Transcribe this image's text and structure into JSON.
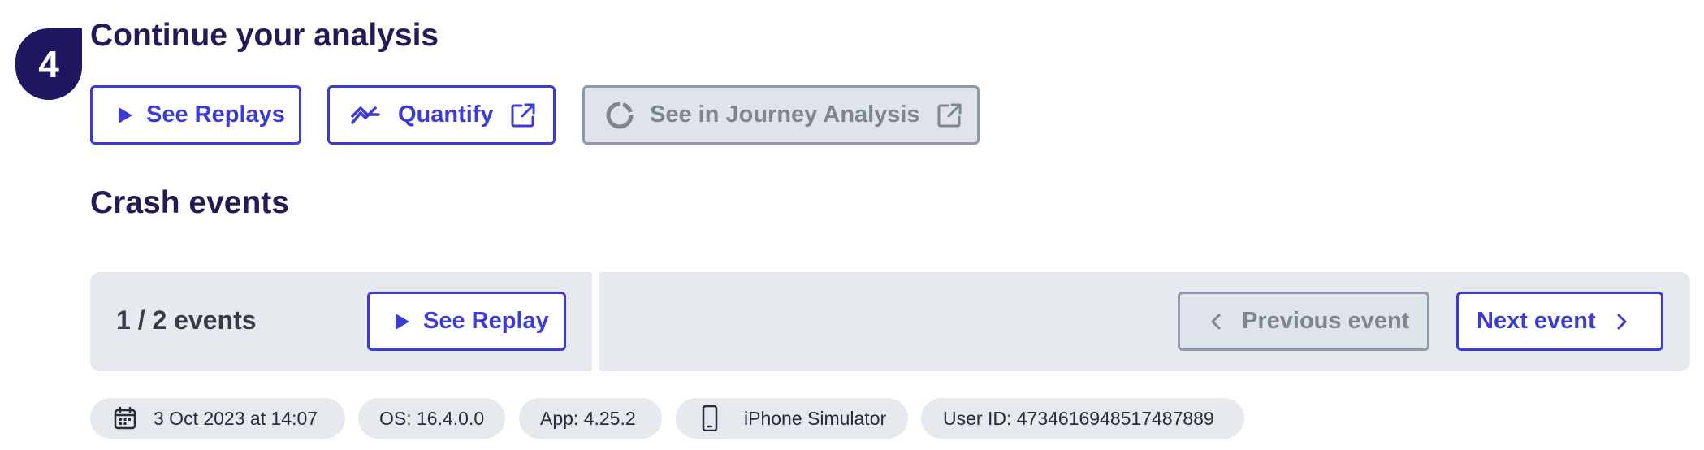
{
  "step": {
    "number": "4"
  },
  "analysis": {
    "title": "Continue your analysis",
    "see_replays_label": "See Replays",
    "quantify_label": "Quantify",
    "journey_label": "See in Journey Analysis"
  },
  "crash": {
    "title": "Crash events",
    "count_label": "1 / 2 events",
    "see_replay_label": "See Replay",
    "previous_label": "Previous event",
    "next_label": "Next event"
  },
  "meta": {
    "date": "3 Oct 2023 at 14:07",
    "os": "OS: 16.4.0.0",
    "app": "App: 4.25.2",
    "device": "iPhone Simulator",
    "user_id": "User ID: 4734616948517487889"
  },
  "colors": {
    "accent": "#3d3bd6",
    "navy": "#1d1660",
    "disabled": "#8e9aab",
    "panel": "#e6e9ee"
  },
  "icons": [
    "play-icon",
    "trend-icon",
    "external-link-icon",
    "loading-spinner-icon",
    "chevron-left-icon",
    "chevron-right-icon",
    "calendar-icon",
    "phone-icon"
  ]
}
